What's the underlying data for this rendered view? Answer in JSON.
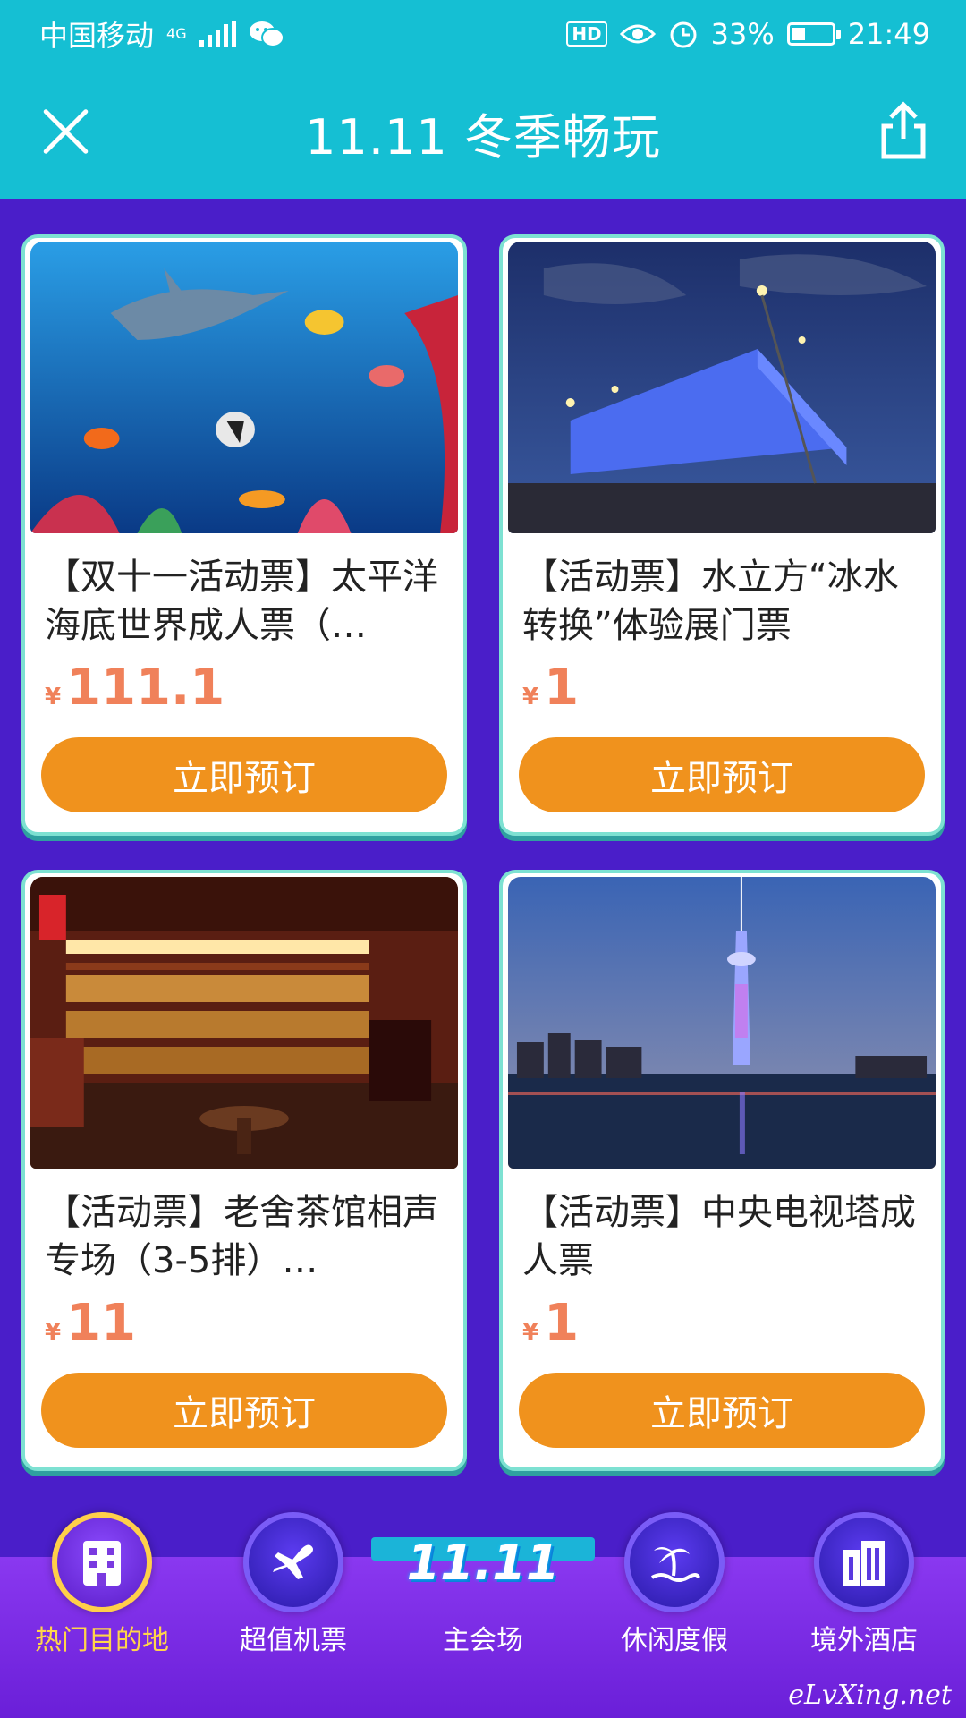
{
  "status": {
    "carrier": "中国移动",
    "network": "4G",
    "hd": "HD",
    "battery": "33%",
    "time": "21:49"
  },
  "header": {
    "title": "11.11 冬季畅玩"
  },
  "cards": [
    {
      "title": "【双十一活动票】太平洋海底世界成人票（…",
      "currency": "¥",
      "price": "111.1",
      "button": "立即预订"
    },
    {
      "title": "【活动票】水立方“冰水转换”体验展门票",
      "currency": "¥",
      "price": "1",
      "button": "立即预订"
    },
    {
      "title": "【活动票】老舍茶馆相声专场（3-5排）…",
      "currency": "¥",
      "price": "11",
      "button": "立即预订"
    },
    {
      "title": "【活动票】中央电视塔成人票",
      "currency": "¥",
      "price": "1",
      "button": "立即预订"
    }
  ],
  "bottom_nav": [
    {
      "label": "热门目的地",
      "icon": "building-icon",
      "active": true
    },
    {
      "label": "超值机票",
      "icon": "airplane-icon",
      "active": false
    },
    {
      "label": "主会场",
      "icon": "1111-logo",
      "logo_text": "11.11",
      "active": false
    },
    {
      "label": "休闲度假",
      "icon": "palm-island-icon",
      "active": false
    },
    {
      "label": "境外酒店",
      "icon": "hotel-icon",
      "active": false
    }
  ],
  "watermark": "eLvXing.net",
  "colors": {
    "header_bg": "#15bfd3",
    "page_bg": "#4a1ec9",
    "price": "#f0815a",
    "button": "#f0921d",
    "active_nav_label": "#ffd54a"
  }
}
